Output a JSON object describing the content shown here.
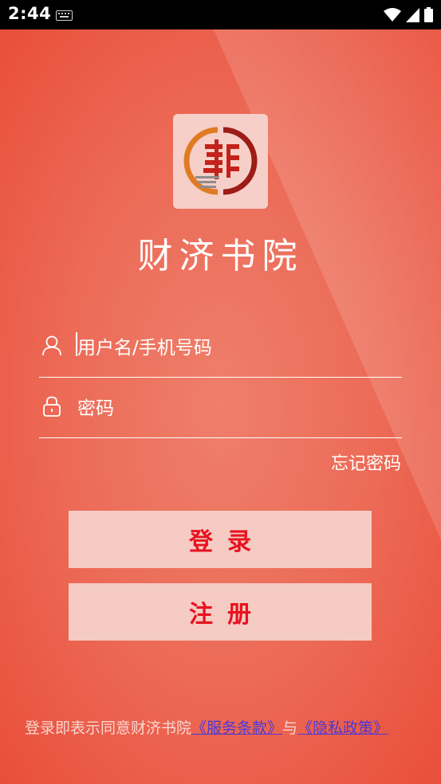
{
  "status_bar": {
    "time": "2:44",
    "icons": [
      "keyboard-icon",
      "wifi-icon",
      "signal-icon",
      "battery-icon"
    ]
  },
  "app": {
    "name": "财济书院",
    "accent": "#e8121f"
  },
  "login_form": {
    "username_placeholder": "用户名/手机号码",
    "password_placeholder": "密码",
    "forgot_password": "忘记密码"
  },
  "buttons": {
    "login": "登录",
    "register": "注册"
  },
  "terms": {
    "prefix": "登录即表示同意财济书院",
    "service_link": "《服务条款》",
    "connector": "与",
    "privacy_link": "《隐私政策》"
  }
}
